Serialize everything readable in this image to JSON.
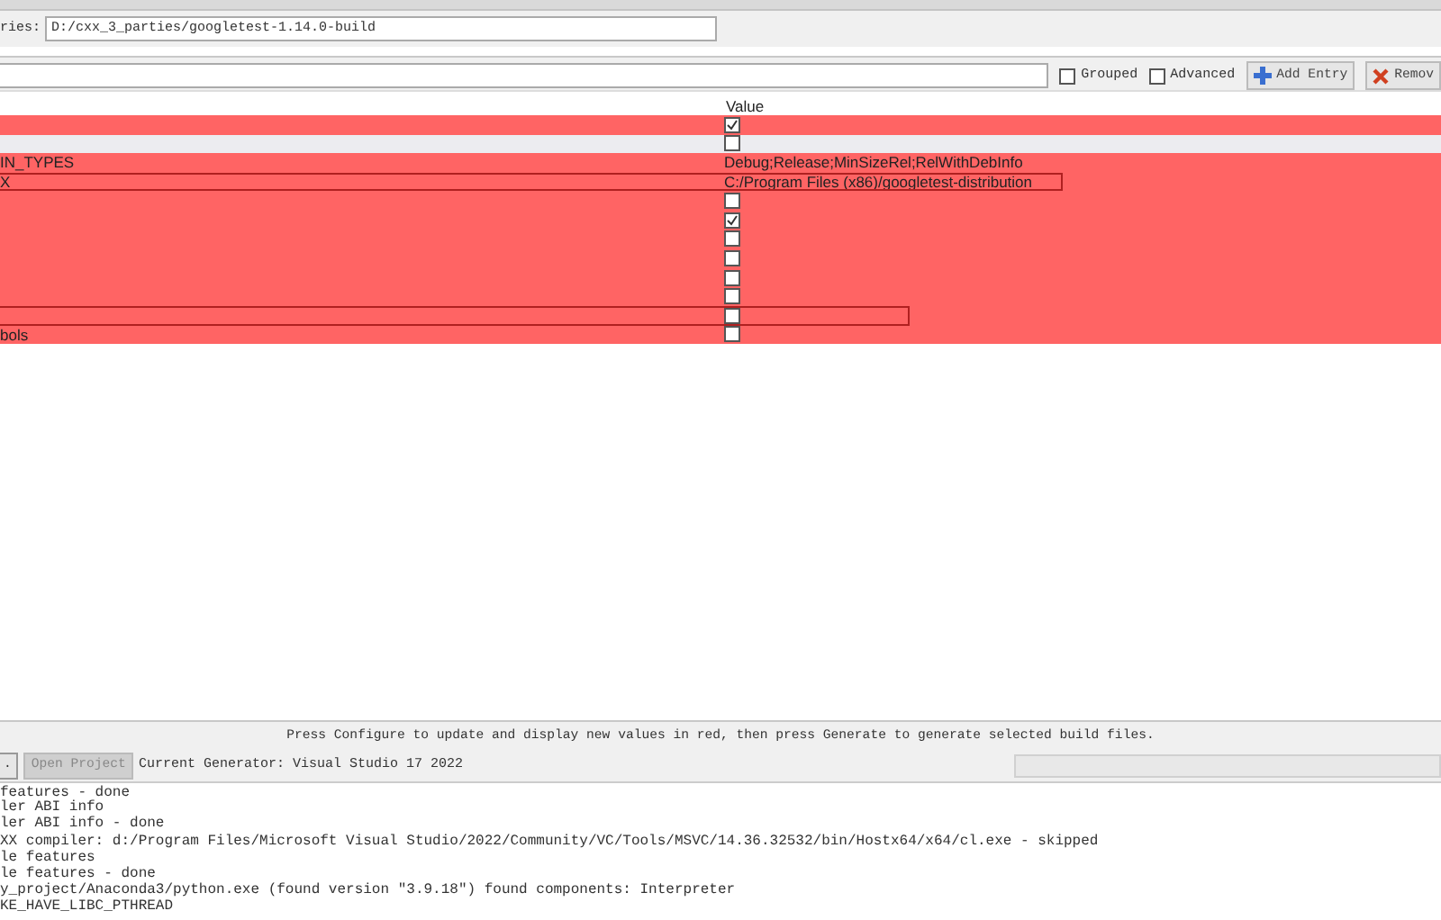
{
  "source": {
    "label": "ries:",
    "value": "D:/cxx_3_parties/googletest-1.14.0-build"
  },
  "toolbar": {
    "grouped": {
      "label": "Grouped",
      "checked": false
    },
    "advanced": {
      "label": "Advanced",
      "checked": false
    },
    "add_entry": "Add Entry",
    "remove": "Remov"
  },
  "table": {
    "columns": [
      "Value"
    ],
    "rows": [
      {
        "kind": "bool",
        "checked": true,
        "changed": true,
        "selected": false
      },
      {
        "kind": "bool",
        "checked": false,
        "changed": false,
        "selected": false
      },
      {
        "kind": "text",
        "name": "IN_TYPES",
        "value": "Debug;Release;MinSizeRel;RelWithDebInfo",
        "changed": true,
        "selected": false
      },
      {
        "kind": "text",
        "name": "X",
        "value": "C:/Program Files (x86)/googletest-distribution",
        "changed": true,
        "selected": true
      },
      {
        "kind": "bool",
        "checked": false,
        "changed": true,
        "selected": false
      },
      {
        "kind": "bool",
        "checked": true,
        "changed": true,
        "selected": false
      },
      {
        "kind": "bool",
        "checked": false,
        "changed": true,
        "selected": false
      },
      {
        "kind": "bool",
        "checked": false,
        "changed": true,
        "selected": false
      },
      {
        "kind": "bool",
        "checked": false,
        "changed": true,
        "selected": false
      },
      {
        "kind": "bool",
        "checked": false,
        "changed": true,
        "selected": false
      },
      {
        "kind": "bool",
        "checked": false,
        "changed": true,
        "selected": true
      },
      {
        "kind": "bool",
        "name": "bols",
        "checked": false,
        "changed": true,
        "selected": false
      }
    ]
  },
  "message": "Press Configure to update and display new values in red, then press Generate to generate selected build files.",
  "actions": {
    "generate": ".",
    "open_project": {
      "label": "Open Project",
      "disabled": true
    },
    "generator": "Current Generator: Visual Studio 17 2022",
    "progress": {
      "level": 0
    }
  },
  "log": [
    "features - done",
    "ler ABI info",
    "ler ABI info - done",
    "XX compiler: d:/Program Files/Microsoft Visual Studio/2022/Community/VC/Tools/MSVC/14.36.32532/bin/Hostx64/x64/cl.exe - skipped",
    "le features",
    "le features - done",
    "y_project/Anaconda3/python.exe (found version \"3.9.18\") found components: Interpreter",
    "KE_HAVE_LIBC_PTHREAD"
  ]
}
